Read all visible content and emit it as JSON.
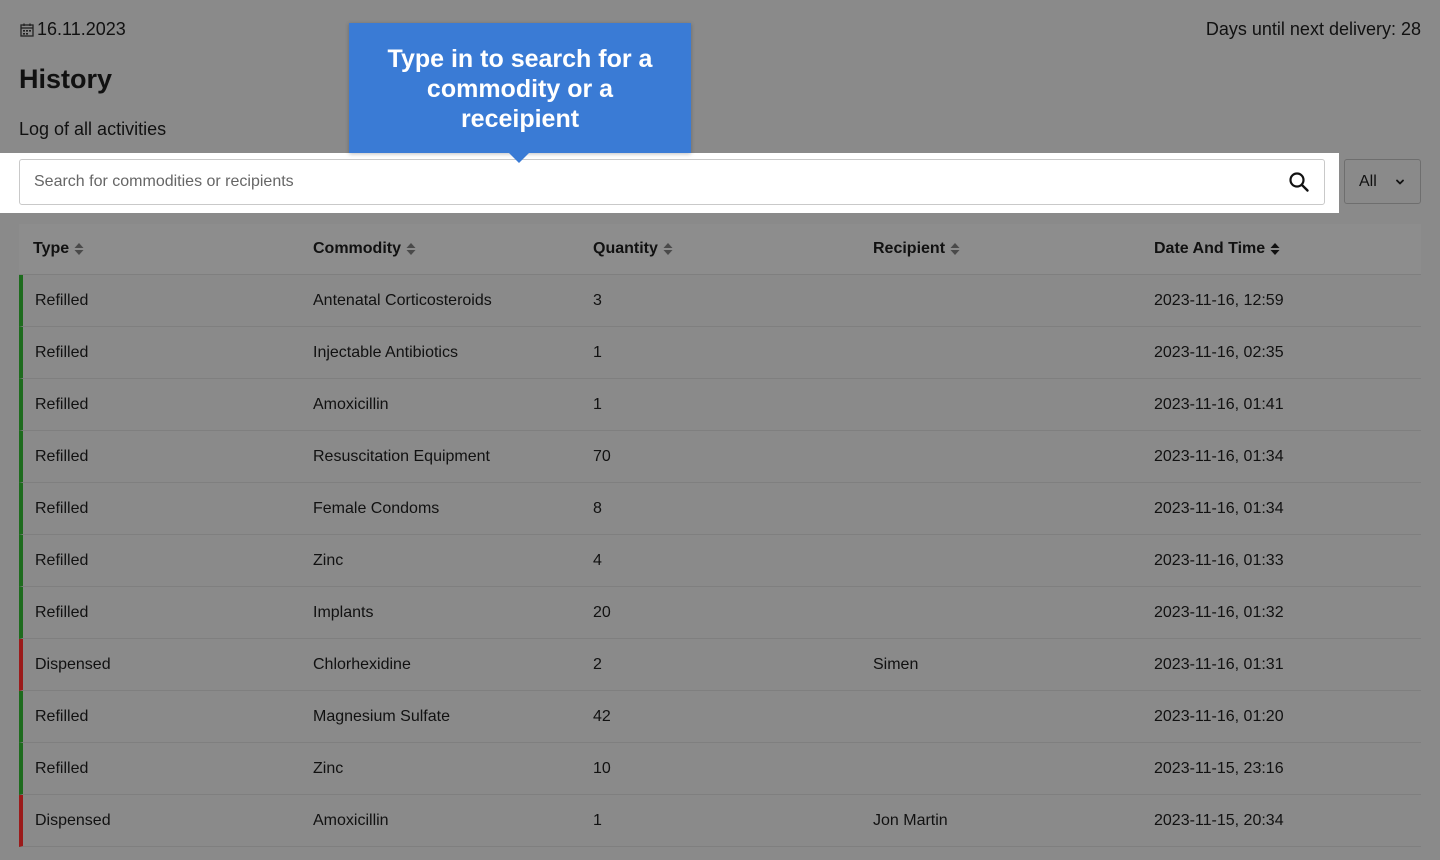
{
  "header": {
    "date": "16.11.2023",
    "delivery": "Days until next delivery: 28",
    "title": "History",
    "subtitle": "Log of all activities"
  },
  "tooltip": {
    "line1": "Type in to search for a",
    "line2": "commodity or a",
    "line3": "receipient"
  },
  "search": {
    "placeholder": "Search for commodities or recipients",
    "value": ""
  },
  "filter": {
    "selected": "All"
  },
  "icons": {
    "date": "calendar-icon",
    "search": "search-icon",
    "filter": "chevron-down-icon",
    "sort": "sort-icon"
  },
  "colors": {
    "refilled_accent": "#1d6b1d",
    "dispensed_accent": "#9b1a1a",
    "tooltip_bg": "#3a7bd5"
  },
  "table": {
    "columns": [
      "Type",
      "Commodity",
      "Quantity",
      "Recipient",
      "Date And Time"
    ],
    "rows": [
      {
        "type": "Refilled",
        "commodity": "Antenatal Corticosteroids",
        "quantity": "3",
        "recipient": "",
        "datetime": "2023-11-16, 12:59"
      },
      {
        "type": "Refilled",
        "commodity": "Injectable Antibiotics",
        "quantity": "1",
        "recipient": "",
        "datetime": "2023-11-16, 02:35"
      },
      {
        "type": "Refilled",
        "commodity": "Amoxicillin",
        "quantity": "1",
        "recipient": "",
        "datetime": "2023-11-16, 01:41"
      },
      {
        "type": "Refilled",
        "commodity": "Resuscitation Equipment",
        "quantity": "70",
        "recipient": "",
        "datetime": "2023-11-16, 01:34"
      },
      {
        "type": "Refilled",
        "commodity": "Female Condoms",
        "quantity": "8",
        "recipient": "",
        "datetime": "2023-11-16, 01:34"
      },
      {
        "type": "Refilled",
        "commodity": "Zinc",
        "quantity": "4",
        "recipient": "",
        "datetime": "2023-11-16, 01:33"
      },
      {
        "type": "Refilled",
        "commodity": "Implants",
        "quantity": "20",
        "recipient": "",
        "datetime": "2023-11-16, 01:32"
      },
      {
        "type": "Dispensed",
        "commodity": "Chlorhexidine",
        "quantity": "2",
        "recipient": "Simen",
        "datetime": "2023-11-16, 01:31"
      },
      {
        "type": "Refilled",
        "commodity": "Magnesium Sulfate",
        "quantity": "42",
        "recipient": "",
        "datetime": "2023-11-16, 01:20"
      },
      {
        "type": "Refilled",
        "commodity": "Zinc",
        "quantity": "10",
        "recipient": "",
        "datetime": "2023-11-15, 23:16"
      },
      {
        "type": "Dispensed",
        "commodity": "Amoxicillin",
        "quantity": "1",
        "recipient": "Jon Martin",
        "datetime": "2023-11-15, 20:34"
      }
    ]
  }
}
